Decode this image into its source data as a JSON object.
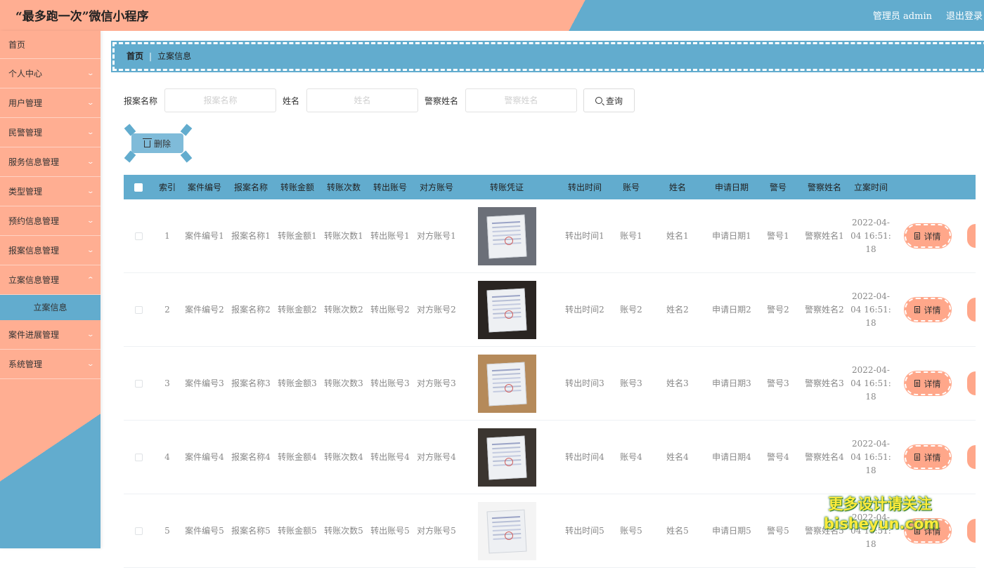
{
  "header": {
    "title": "“最多跑一次”微信小程序",
    "user_label": "管理员 admin",
    "logout_label": "退出登录"
  },
  "sidebar": {
    "items": [
      {
        "label": "首页"
      },
      {
        "label": "个人中心"
      },
      {
        "label": "用户管理"
      },
      {
        "label": "民警管理"
      },
      {
        "label": "服务信息管理"
      },
      {
        "label": "类型管理"
      },
      {
        "label": "预约信息管理"
      },
      {
        "label": "报案信息管理"
      },
      {
        "label": "立案信息管理"
      },
      {
        "label": "案件进展管理"
      },
      {
        "label": "系统管理"
      }
    ],
    "submenu_active": "立案信息"
  },
  "breadcrumb": {
    "home": "首页",
    "separator": "|",
    "current": "立案信息"
  },
  "search": {
    "label1": "报案名称",
    "placeholder1": "报案名称",
    "label2": "姓名",
    "placeholder2": "姓名",
    "label3": "警察姓名",
    "placeholder3": "警察姓名",
    "button": "查询"
  },
  "toolbar": {
    "delete_label": "删除"
  },
  "table": {
    "headers": [
      "索引",
      "案件编号",
      "报案名称",
      "转账金额",
      "转账次数",
      "转出账号",
      "对方账号",
      "转账凭证",
      "转出时间",
      "账号",
      "姓名",
      "申请日期",
      "警号",
      "警察姓名",
      "立案时间"
    ],
    "detail_label": "详情",
    "rows": [
      {
        "idx": "1",
        "case_no": "案件编号1",
        "report": "报案名称1",
        "amount": "转账金额1",
        "count": "转账次数1",
        "out_acc": "转出账号1",
        "peer_acc": "对方账号1",
        "out_time": "转出时间1",
        "account": "账号1",
        "name": "姓名1",
        "apply": "申请日期1",
        "police_no": "警号1",
        "police_name": "警察姓名1",
        "file_time": "2022-04-04 16:51:18"
      },
      {
        "idx": "2",
        "case_no": "案件编号2",
        "report": "报案名称2",
        "amount": "转账金额2",
        "count": "转账次数2",
        "out_acc": "转出账号2",
        "peer_acc": "对方账号2",
        "out_time": "转出时间2",
        "account": "账号2",
        "name": "姓名2",
        "apply": "申请日期2",
        "police_no": "警号2",
        "police_name": "警察姓名2",
        "file_time": "2022-04-04 16:51:18"
      },
      {
        "idx": "3",
        "case_no": "案件编号3",
        "report": "报案名称3",
        "amount": "转账金额3",
        "count": "转账次数3",
        "out_acc": "转出账号3",
        "peer_acc": "对方账号3",
        "out_time": "转出时间3",
        "account": "账号3",
        "name": "姓名3",
        "apply": "申请日期3",
        "police_no": "警号3",
        "police_name": "警察姓名3",
        "file_time": "2022-04-04 16:51:18"
      },
      {
        "idx": "4",
        "case_no": "案件编号4",
        "report": "报案名称4",
        "amount": "转账金额4",
        "count": "转账次数4",
        "out_acc": "转出账号4",
        "peer_acc": "对方账号4",
        "out_time": "转出时间4",
        "account": "账号4",
        "name": "姓名4",
        "apply": "申请日期4",
        "police_no": "警号4",
        "police_name": "警察姓名4",
        "file_time": "2022-04-04 16:51:18"
      },
      {
        "idx": "5",
        "case_no": "案件编号5",
        "report": "报案名称5",
        "amount": "转账金额5",
        "count": "转账次数5",
        "out_acc": "转出账号5",
        "peer_acc": "对方账号5",
        "out_time": "转出时间5",
        "account": "账号5",
        "name": "姓名5",
        "apply": "申请日期5",
        "police_no": "警号5",
        "police_name": "警察姓名5",
        "file_time": "2022-04-04 16:51:18"
      }
    ]
  },
  "watermark": {
    "line1": "更多设计请关注",
    "line2": "bisheyun.com"
  },
  "colors": {
    "peach": "#ffae92",
    "blue": "#62acce",
    "button_peach": "#ffa78a"
  }
}
